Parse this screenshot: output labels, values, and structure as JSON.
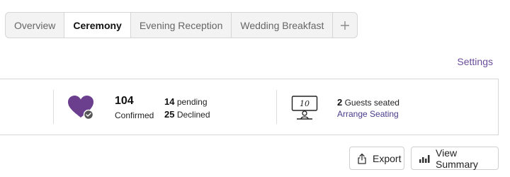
{
  "tabs": [
    {
      "label": "Overview",
      "active": false
    },
    {
      "label": "Ceremony",
      "active": true
    },
    {
      "label": "Evening Reception",
      "active": false
    },
    {
      "label": "Wedding Breakfast",
      "active": false
    }
  ],
  "add_tab_icon": "plus-icon",
  "settings_label": "Settings",
  "stats": {
    "confirmed_count": "104",
    "confirmed_label": "Confirmed",
    "pending_count": "14",
    "pending_label": "pending",
    "declined_count": "25",
    "declined_label": "Declined",
    "seated_count": "2",
    "seated_label": "Guests seated",
    "arrange_label": "Arrange Seating",
    "table_number": "10",
    "heart_color": "#6b3e8e"
  },
  "buttons": {
    "export_label": "Export",
    "summary_label": "View Summary"
  }
}
